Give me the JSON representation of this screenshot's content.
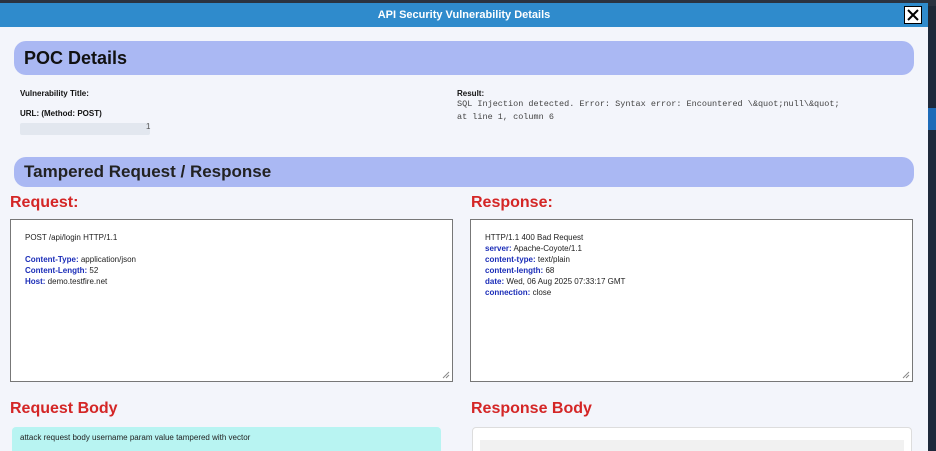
{
  "window": {
    "title": "API Security Vulnerability Details"
  },
  "poc": {
    "heading": "POC Details",
    "vuln_title_label": "Vulnerability Title:",
    "url_label": "URL: (Method: POST)",
    "url_tail": "1",
    "result_label": "Result:",
    "result_line1": "SQL Injection detected. Error: Syntax error: Encountered \\&quot;null\\&quot;",
    "result_line2": "at line 1, column 6"
  },
  "tampered": {
    "heading": "Tampered Request / Response"
  },
  "request": {
    "heading": "Request:",
    "request_line": "POST /api/login HTTP/1.1",
    "headers": [
      {
        "key": "Content-Type:",
        "value": " application/json"
      },
      {
        "key": "Content-Length:",
        "value": " 52"
      },
      {
        "key": "Host:",
        "value": " demo.testfire.net"
      }
    ]
  },
  "response": {
    "heading": "Response:",
    "status_line": "HTTP/1.1 400 Bad Request",
    "headers": [
      {
        "key": "server:",
        "value": " Apache-Coyote/1.1"
      },
      {
        "key": "content-type:",
        "value": " text/plain"
      },
      {
        "key": "content-length:",
        "value": " 68"
      },
      {
        "key": "date:",
        "value": " Wed, 06 Aug 2025 07:33:17 GMT"
      },
      {
        "key": "connection:",
        "value": " close"
      }
    ]
  },
  "request_body": {
    "heading": "Request Body",
    "text": "attack request body username param value tampered with vector"
  },
  "response_body": {
    "heading": "Response Body"
  },
  "colors": {
    "titlebar": "#2f8bcc",
    "banner": "#aab8f3",
    "section_red": "#d42626",
    "header_key_blue": "#1b2db8",
    "body_cyan": "#b8f4f2"
  }
}
